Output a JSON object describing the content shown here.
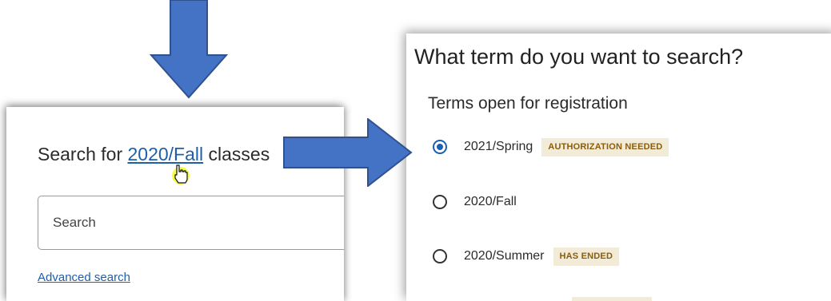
{
  "left_panel": {
    "heading_prefix": "Search for ",
    "term_link": "2020/Fall",
    "heading_suffix": " classes",
    "search_placeholder": "Search",
    "advanced_search": "Advanced search"
  },
  "term_dialog": {
    "title": "What term do you want to search?",
    "section_label": "Terms open for registration",
    "terms": [
      {
        "label": "2021/Spring",
        "badge": "AUTHORIZATION NEEDED",
        "selected": true
      },
      {
        "label": "2020/Fall",
        "badge": "",
        "selected": false
      },
      {
        "label": "2020/Summer",
        "badge": "HAS ENDED",
        "selected": false
      }
    ]
  },
  "colors": {
    "annotation_arrow": "#4472c4",
    "link": "#1f5fa8",
    "radio_selected": "#1a5fb4",
    "badge_bg": "#f1ebd8",
    "badge_text": "#8a5c0b"
  },
  "icons": [
    "down-arrow-annotation",
    "right-arrow-annotation",
    "hand-pointer-cursor"
  ]
}
